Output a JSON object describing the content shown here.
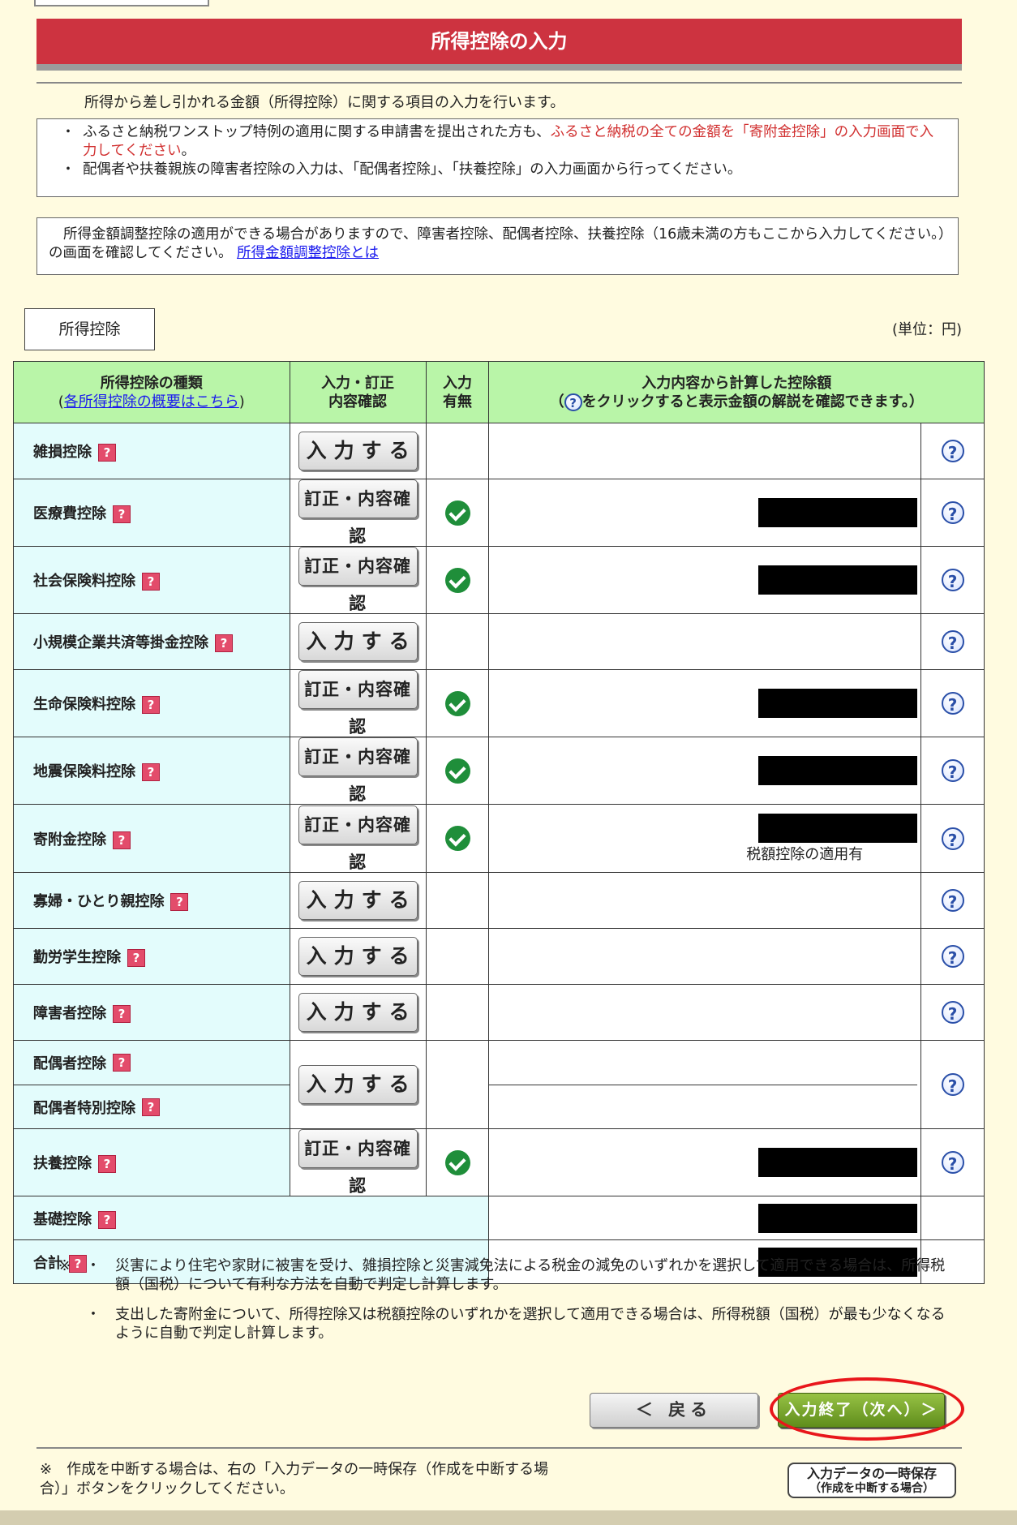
{
  "header": {
    "title": "所得控除の入力"
  },
  "intro": "所得から差し引かれる金額（所得控除）に関する項目の入力を行います。",
  "notice1": {
    "bullet": "・",
    "line1_black": "ふるさと納税ワンストップ特例の適用に関する申請書を提出された方も、",
    "line1_red": "ふるさと納税の全ての金額を「寄附金控除」の入力画面で入力してください",
    "line1_end": "。",
    "line2": "配偶者や扶養親族の障害者控除の入力は、「配偶者控除」、「扶養控除」の入力画面から行ってください。"
  },
  "notice2": {
    "text": "所得金額調整控除の適用ができる場合がありますので、障害者控除、配偶者控除、扶養控除（16歳未満の方もここから入力してください。）の画面を確認してください。",
    "link": "所得金額調整控除とは"
  },
  "section_tab": "所得控除",
  "unit": "(単位：円)",
  "table": {
    "headers": {
      "col1_line1": "所得控除の種類",
      "col1_link": "各所得控除の概要はこちら",
      "col2_line1": "入力・訂正",
      "col2_line2": "内容確認",
      "col3_line1": "入力",
      "col3_line2": "有無",
      "col4_line1": "入力内容から計算した控除額",
      "col4_line2": "をクリックすると表示金額の解説を確認できます。）",
      "col4_open": "（"
    },
    "rows": [
      {
        "name": "雑損控除",
        "button": "入力する",
        "checked": false,
        "amount": ""
      },
      {
        "name": "医療費控除",
        "button": "訂正・内容確認",
        "checked": true,
        "amount": "redacted"
      },
      {
        "name": "社会保険料控除",
        "button": "訂正・内容確認",
        "checked": true,
        "amount": "redacted"
      },
      {
        "name": "小規模企業共済等掛金控除",
        "button": "入力する",
        "checked": false,
        "amount": ""
      },
      {
        "name": "生命保険料控除",
        "button": "訂正・内容確認",
        "checked": true,
        "amount": "redacted"
      },
      {
        "name": "地震保険料控除",
        "button": "訂正・内容確認",
        "checked": true,
        "amount": "redacted"
      },
      {
        "name": "寄附金控除",
        "button": "訂正・内容確認",
        "checked": true,
        "amount": "redacted",
        "note": "税額控除の適用有"
      },
      {
        "name": "寡婦・ひとり親控除",
        "button": "入力する",
        "checked": false,
        "amount": ""
      },
      {
        "name": "勤労学生控除",
        "button": "入力する",
        "checked": false,
        "amount": ""
      },
      {
        "name": "障害者控除",
        "button": "入力する",
        "checked": false,
        "amount": ""
      },
      {
        "name": "配偶者控除",
        "name2": "配偶者特別控除",
        "button": "入力する",
        "checked": false,
        "amount": ""
      },
      {
        "name": "扶養控除",
        "button": "訂正・内容確認",
        "checked": true,
        "amount": "redacted"
      },
      {
        "name": "基礎控除",
        "amount": "redacted"
      },
      {
        "name": "合計",
        "amount": "redacted"
      }
    ]
  },
  "footnotes": {
    "mark": "※",
    "note1": "災害により住宅や家財に被害を受け、雑損控除と災害減免法による税金の減免のいずれかを選択して適用できる場合は、所得税額（国税）について有利な方法を自動で判定し計算します。",
    "note2": "支出した寄附金について、所得控除又は税額控除のいずれかを選択して適用できる場合は、所得税額（国税）が最も少なくなるように自動で判定し計算します。"
  },
  "nav": {
    "back": "＜ 戻る",
    "next": "入力終了（次へ）＞"
  },
  "bottom": {
    "note": "※　作成を中断する場合は、右の「入力データの一時保存（作成を中断する場合）」ボタンをクリックしてください。",
    "save_line1": "入力データの一時保存",
    "save_line2": "（作成を中断する場合）"
  },
  "colors": {
    "title_bg": "#cd3340",
    "header_bg": "#b9f5a8",
    "name_bg": "#e3fcfc",
    "next_btn": "#7aa833",
    "highlight": "#e8161b"
  }
}
